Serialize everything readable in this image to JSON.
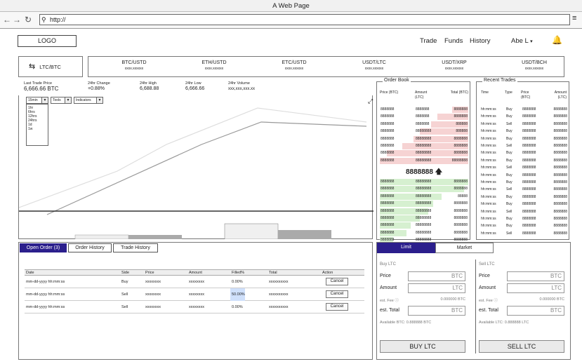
{
  "window": {
    "title": "A Web Page"
  },
  "browser": {
    "url": "http://"
  },
  "header": {
    "logo": "LOGO",
    "nav": [
      "Trade",
      "Funds",
      "History"
    ],
    "user": "Abe L"
  },
  "pair": {
    "label": "LTC/BTC"
  },
  "tickers": [
    {
      "pair": "BTC/USTD",
      "value": "xxxx.xxxxxx"
    },
    {
      "pair": "ETH/USTD",
      "value": "xxxx.xxxxxx"
    },
    {
      "pair": "ETC/USTD",
      "value": "xxxx.xxxxxx"
    },
    {
      "pair": "USDT/LTC",
      "value": "xxxx.xxxxxx"
    },
    {
      "pair": "USDT/XRP",
      "value": "xxxx.xxxxxx"
    },
    {
      "pair": "USDT/BCH",
      "value": "xxxx.xxxxxx"
    }
  ],
  "stats": [
    {
      "label": "Last Trade Price",
      "value": "6,666.66 BTC"
    },
    {
      "label": "24hr Change",
      "value": "+0.88%"
    },
    {
      "label": "24hr High",
      "value": "6,688.88"
    },
    {
      "label": "24hr Low",
      "value": "6,666.66"
    },
    {
      "label": "24hr Volume",
      "value": "xxx,xxx,xxx.xx"
    }
  ],
  "chart": {
    "interval": "15min",
    "tools": "Tools",
    "indicators": "Indicators",
    "intervals": [
      "1hr",
      "6hrs",
      "12hrs",
      "24hrs",
      "1d",
      "1w"
    ]
  },
  "orderbook": {
    "title": "Order Book",
    "headers": [
      "Price (BTC)",
      "Amount (LTC)",
      "Total (BTC)"
    ],
    "asks": [
      [
        "8888888",
        "8888888",
        "8888888",
        0.18
      ],
      [
        "8888888",
        "8888888",
        "8888888",
        0.35
      ],
      [
        "8888888",
        "8888888",
        "888888",
        0.42
      ],
      [
        "8888888",
        "88888888",
        "888888",
        0.55
      ],
      [
        "8888888",
        "88888888",
        "8888888",
        0.62
      ],
      [
        "8888888",
        "88888888",
        "8888888",
        0.75
      ],
      [
        "8888888",
        "88888888",
        "8888888",
        0.92
      ],
      [
        "8888888",
        "88888888",
        "88888888",
        1.0
      ]
    ],
    "last_price": "8888888",
    "bids": [
      [
        "8888888",
        "88888888",
        "8888888",
        1.0
      ],
      [
        "8888888",
        "88888888",
        "8888888",
        0.95
      ],
      [
        "8888888",
        "88888888",
        "88888",
        0.7
      ],
      [
        "8888888",
        "88888888",
        "8888888",
        0.6
      ],
      [
        "8888888",
        "88888888",
        "8888888",
        0.55
      ],
      [
        "8888888",
        "88888888",
        "8888888",
        0.45
      ],
      [
        "8888888",
        "88888888",
        "8888888",
        0.35
      ],
      [
        "8888888",
        "88888888",
        "8888888",
        0.3
      ],
      [
        "8888888",
        "88888888",
        "8888888",
        0.15
      ]
    ]
  },
  "recent": {
    "title": "Recent Trades",
    "headers": [
      "Time",
      "Type",
      "Price (BTC)",
      "Amount (LTC)"
    ],
    "rows": [
      [
        "hh:mm:ss",
        "Buy",
        "8888888",
        "8888888"
      ],
      [
        "hh:mm:ss",
        "Buy",
        "8888888",
        "8888888"
      ],
      [
        "hh:mm:ss",
        "Sell",
        "8888888",
        "8888888"
      ],
      [
        "hh:mm:ss",
        "Buy",
        "8888888",
        "8888888"
      ],
      [
        "hh:mm:ss",
        "Buy",
        "8888888",
        "8888888"
      ],
      [
        "hh:mm:ss",
        "Sell",
        "8888888",
        "8888888"
      ],
      [
        "hh:mm:ss",
        "Buy",
        "8888888",
        "8888888"
      ],
      [
        "hh:mm:ss",
        "Buy",
        "8888888",
        "8888888"
      ],
      [
        "hh:mm:ss",
        "Sell",
        "8888888",
        "8888888"
      ],
      [
        "hh:mm:ss",
        "Buy",
        "8888888",
        "8888888"
      ],
      [
        "hh:mm:ss",
        "Buy",
        "8888888",
        "8888888"
      ],
      [
        "hh:mm:ss",
        "Sell",
        "8888888",
        "8888888"
      ],
      [
        "hh:mm:ss",
        "Buy",
        "8888888",
        "8888888"
      ],
      [
        "hh:mm:ss",
        "Buy",
        "8888888",
        "8888888"
      ],
      [
        "hh:mm:ss",
        "Sell",
        "8888888",
        "8888888"
      ],
      [
        "hh:mm:ss",
        "Buy",
        "8888888",
        "8888888"
      ],
      [
        "hh:mm:ss",
        "Buy",
        "8888888",
        "8888888"
      ],
      [
        "hh:mm:ss",
        "Sell",
        "8888888",
        "8888888"
      ]
    ]
  },
  "orders": {
    "tabs": [
      "Open Order (3)",
      "Order History",
      "Trade History"
    ],
    "headers": [
      "Date",
      "Side",
      "Price",
      "Amount",
      "Filled%",
      "Total",
      "Action"
    ],
    "rows": [
      [
        "mm-dd-yyyy hh:mm:ss",
        "Buy",
        "xxxxxxxx",
        "xxxxxxxx",
        "0.00%",
        "xxxxxxxxxx",
        "Cancel"
      ],
      [
        "mm-dd-yyyy hh:mm:ss",
        "Sell",
        "xxxxxxxx",
        "xxxxxxxx",
        "50.00%",
        "xxxxxxxxxx",
        "Cancel"
      ],
      [
        "mm-dd-yyyy hh:mm:ss",
        "Sell",
        "xxxxxxxx",
        "xxxxxxxx",
        "0.00%",
        "xxxxxxxxxx",
        "Cancel"
      ]
    ]
  },
  "trade": {
    "tabs": [
      "Limit",
      "Market"
    ],
    "buy": {
      "title": "Buy LTC",
      "price": "Price",
      "price_unit": "BTC",
      "amount": "Amount",
      "amount_unit": "LTC",
      "fee": "est. Fee",
      "fee_value": "0.000000 BTC",
      "total": "est. Total",
      "total_unit": "BTC",
      "available": "Available BTC: 0.888888 BTC",
      "button": "BUY LTC"
    },
    "sell": {
      "title": "Sell LTC",
      "price": "Price",
      "price_unit": "BTC",
      "amount": "Amount",
      "amount_unit": "LTC",
      "fee": "est. Fee",
      "fee_value": "0.000000 BTC",
      "total": "est. Total",
      "total_unit": "BTC",
      "available": "Available LTC: 0.888888 LTC",
      "button": "SELL LTC"
    }
  },
  "colors": {
    "accent": "#2b1f8c",
    "ask": "#f6d3d3",
    "bid": "#d6f0d0"
  }
}
